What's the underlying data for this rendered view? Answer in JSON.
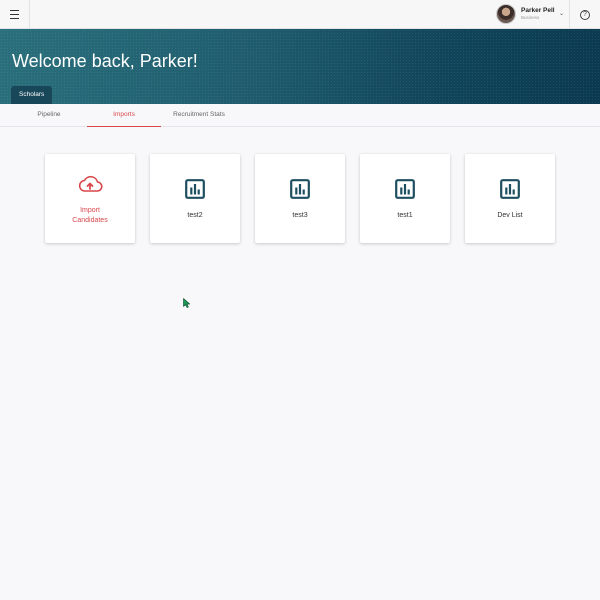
{
  "header": {
    "user_name": "Parker Pell",
    "user_role": "Business"
  },
  "banner": {
    "welcome": "Welcome back, Parker!",
    "tab_label": "Scholars"
  },
  "subnav": {
    "tabs": [
      {
        "label": "Pipeline",
        "active": false
      },
      {
        "label": "Imports",
        "active": true
      },
      {
        "label": "Recruitment Stats",
        "active": false
      }
    ]
  },
  "cards": {
    "import": {
      "line1": "Import",
      "line2": "Candidates"
    },
    "lists": [
      {
        "label": "test2"
      },
      {
        "label": "test3"
      },
      {
        "label": "test1"
      },
      {
        "label": "Dev List"
      }
    ]
  },
  "colors": {
    "accent": "#d9474b",
    "icon": "#1e4f61",
    "banner": "#104459"
  },
  "icons": {
    "menu": "hamburger-icon",
    "help": "question-circle-icon",
    "import": "cloud-upload-icon",
    "list": "bar-chart-icon"
  }
}
